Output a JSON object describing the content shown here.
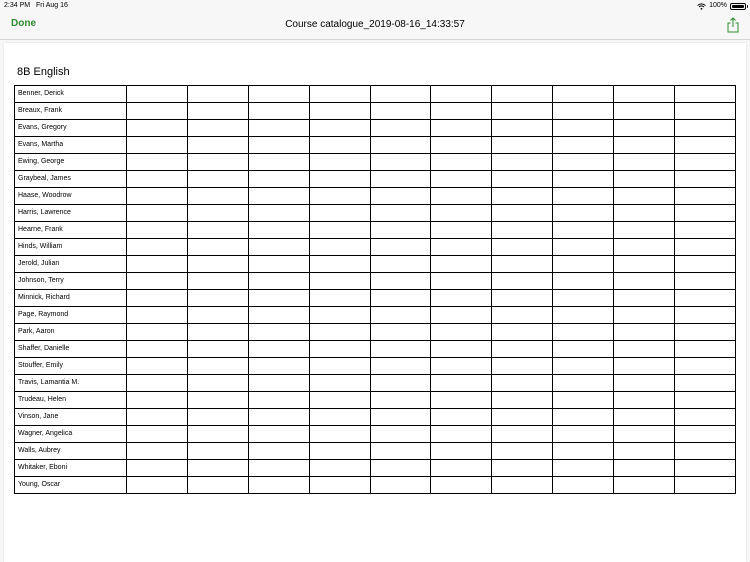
{
  "status_bar": {
    "time": "2:34 PM",
    "date": "Fri Aug 16",
    "battery": "100%"
  },
  "nav": {
    "done_label": "Done",
    "title": "Course catalogue_2019-08-16_14:33:57"
  },
  "document": {
    "heading": "8B English",
    "empty_columns": 10,
    "students": [
      "Benner, Derick",
      "Breaux, Frank",
      "Evans, Gregory",
      "Evans, Martha",
      "Ewing, George",
      "Graybeal, James",
      "Haase, Woodrow",
      "Harris, Lawrence",
      "Hearne, Frank",
      "Hinds, William",
      "Jerold, Julian",
      "Johnson, Terry",
      "Minnick, Richard",
      "Page, Raymond",
      "Park, Aaron",
      "Shaffer, Danielle",
      "Stouffer, Emily",
      "Travis, Lamantia M.",
      "Trudeau, Helen",
      "Vinson, Jane",
      "Wagner, Angelica",
      "Walls, Aubrey",
      "Whitaker, Eboni",
      "Young, Oscar"
    ]
  },
  "colors": {
    "accent": "#2e8b2e",
    "background": "#f7f7f7",
    "page": "#ffffff"
  }
}
